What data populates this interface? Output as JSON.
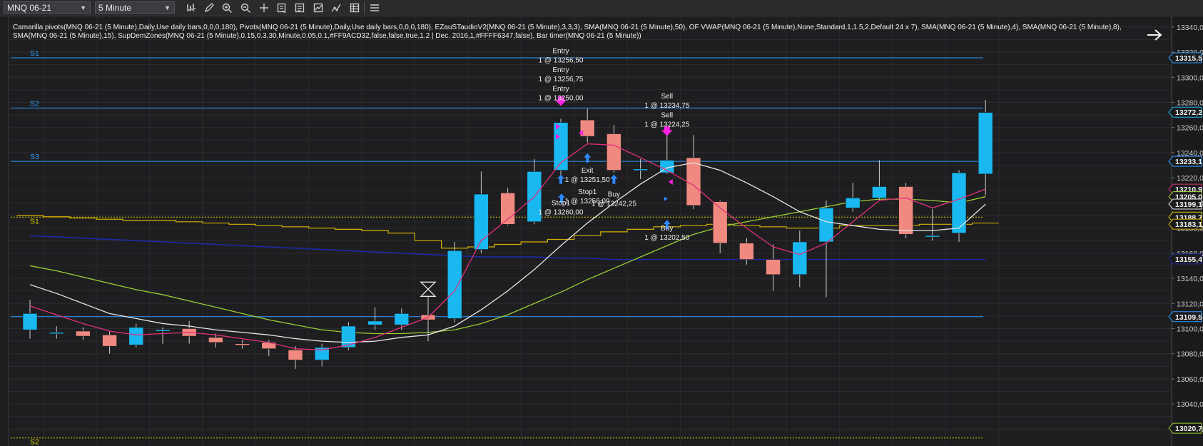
{
  "toolbar": {
    "instrument": "MNQ 06-21",
    "interval": "5 Minute",
    "tools": [
      "bar-style-icon",
      "draw-pen-icon",
      "zoom-in-icon",
      "zoom-out-icon",
      "crosshair-icon",
      "data-box-icon",
      "properties-icon",
      "indicators-icon",
      "strategies-icon",
      "menu-icon"
    ]
  },
  "indicators_text": "Camarilla pivots(MNQ 06-21 (5 Minute),Daily,Use daily bars,0,0,0,180), Pivots(MNQ 06-21 (5 Minute),Daily,Use daily bars,0,0,0,180), EZauSTaudioV2(MNQ 06-21 (5 Minute),3,3,3), SMA(MNQ 06-21 (5 Minute),50), OF VWAP(MNQ 06-21 (5 Minute),None,Standard,1,1.5,2,Default 24 x 7), SMA(MNQ 06-21 (5 Minute),4), SMA(MNQ 06-21 (5 Minute),8), SMA(MNQ 06-21 (5 Minute),15), SupDemZones(MNQ 06-21 (5 Minute),0.15,0.3,30,Minute,0.05,0.1,#FF9ACD32,false,false,true,1.2 | Dec. 2016,1,#FFFF6347,false), Bar timer(MNQ 06-21 (5 Minute))",
  "colors": {
    "up": "#19b8f0",
    "down": "#f08a80",
    "sma4": "#e0307a",
    "sma8": "#e6e6e6",
    "sma15": "#9acd32",
    "sma50": "#1c2aa6",
    "vwap": "#d4b106",
    "camarilla": "#2f9bff",
    "pivot": "#d8d000",
    "marker": "#ff22e0",
    "arrow": "#2e8bff"
  },
  "chart_data": {
    "type": "candlestick",
    "y_range": [
      13010,
      13345
    ],
    "y_ticks": [
      "13340,00",
      "13320,00",
      "13300,00",
      "13280,00",
      "13260,00",
      "13240,00",
      "13220,00",
      "13200,00",
      "13180,00",
      "13160,00",
      "13140,00",
      "13120,00",
      "13100,00",
      "13080,00",
      "13060,00",
      "13040,00",
      "13020,00"
    ],
    "price_labels": [
      {
        "text": "13315,5",
        "value": 13315.5,
        "color": "#2f9bff"
      },
      {
        "text": "13272,2",
        "value": 13272.2,
        "color": "#19b8f0"
      },
      {
        "text": "13233,1",
        "value": 13233.1,
        "color": "#2f9bff"
      },
      {
        "text": "13210,9",
        "value": 13210.9,
        "color": "#e0307a"
      },
      {
        "text": "13205,0",
        "value": 13205.0,
        "color": "#9acd32"
      },
      {
        "text": "13199,1",
        "value": 13199.1,
        "color": "#e6e6e6"
      },
      {
        "text": "13188,7",
        "value": 13188.7,
        "color": "#d8d000"
      },
      {
        "text": "13183,1",
        "value": 13183.1,
        "color": "#d4b106"
      },
      {
        "text": "13155,4",
        "value": 13155.4,
        "color": "#1c2aa6"
      },
      {
        "text": "13109,5",
        "value": 13109.5,
        "color": "#2f9bff"
      },
      {
        "text": "13020,7",
        "value": 13020.7,
        "color": "#9acd32"
      }
    ],
    "levels": [
      {
        "label": "S1",
        "value": 13315.5,
        "kind": "camarilla"
      },
      {
        "label": "S2",
        "value": 13275.5,
        "kind": "camarilla"
      },
      {
        "label": "S3",
        "value": 13233.1,
        "kind": "camarilla"
      },
      {
        "label": "",
        "value": 13109.5,
        "kind": "camarilla"
      },
      {
        "label": "S1",
        "value": 13188.7,
        "kind": "pivot"
      },
      {
        "label": "S2",
        "value": 13013.0,
        "kind": "pivot"
      }
    ],
    "candles": [
      {
        "o": 13099,
        "h": 13123,
        "l": 13092,
        "c": 13112
      },
      {
        "o": 13096,
        "h": 13102,
        "l": 13092,
        "c": 13097
      },
      {
        "o": 13098,
        "h": 13101,
        "l": 13091,
        "c": 13094
      },
      {
        "o": 13095,
        "h": 13098,
        "l": 13080,
        "c": 13086
      },
      {
        "o": 13087,
        "h": 13104,
        "l": 13085,
        "c": 13101
      },
      {
        "o": 13099,
        "h": 13101,
        "l": 13088,
        "c": 13099
      },
      {
        "o": 13100,
        "h": 13106,
        "l": 13088,
        "c": 13094
      },
      {
        "o": 13093,
        "h": 13096,
        "l": 13085,
        "c": 13089
      },
      {
        "o": 13088,
        "h": 13091,
        "l": 13084,
        "c": 13087
      },
      {
        "o": 13089,
        "h": 13091,
        "l": 13078,
        "c": 13084
      },
      {
        "o": 13083,
        "h": 13086,
        "l": 13068,
        "c": 13075
      },
      {
        "o": 13075,
        "h": 13088,
        "l": 13070,
        "c": 13085
      },
      {
        "o": 13085,
        "h": 13105,
        "l": 13083,
        "c": 13102
      },
      {
        "o": 13103,
        "h": 13117,
        "l": 13099,
        "c": 13106
      },
      {
        "o": 13103,
        "h": 13116,
        "l": 13099,
        "c": 13112
      },
      {
        "o": 13111,
        "h": 13126,
        "l": 13090,
        "c": 13107
      },
      {
        "o": 13108,
        "h": 13169,
        "l": 13105,
        "c": 13162
      },
      {
        "o": 13163,
        "h": 13225,
        "l": 13160,
        "c": 13207
      },
      {
        "o": 13208,
        "h": 13212,
        "l": 13182,
        "c": 13183
      },
      {
        "o": 13185,
        "h": 13235,
        "l": 13183,
        "c": 13225
      },
      {
        "o": 13226,
        "h": 13267,
        "l": 13220,
        "c": 13264
      },
      {
        "o": 13266,
        "h": 13275,
        "l": 13248,
        "c": 13253
      },
      {
        "o": 13255,
        "h": 13262,
        "l": 13224,
        "c": 13226
      },
      {
        "o": 13227,
        "h": 13235,
        "l": 13219,
        "c": 13227
      },
      {
        "o": 13224,
        "h": 13256,
        "l": 13223,
        "c": 13234
      },
      {
        "o": 13236,
        "h": 13254,
        "l": 13195,
        "c": 13198
      },
      {
        "o": 13201,
        "h": 13202,
        "l": 13160,
        "c": 13168
      },
      {
        "o": 13168,
        "h": 13172,
        "l": 13151,
        "c": 13155
      },
      {
        "o": 13155,
        "h": 13167,
        "l": 13130,
        "c": 13143
      },
      {
        "o": 13143,
        "h": 13178,
        "l": 13133,
        "c": 13169
      },
      {
        "o": 13169,
        "h": 13202,
        "l": 13125,
        "c": 13196
      },
      {
        "o": 13196,
        "h": 13216,
        "l": 13193,
        "c": 13204
      },
      {
        "o": 13204,
        "h": 13234,
        "l": 13202,
        "c": 13213
      },
      {
        "o": 13213,
        "h": 13216,
        "l": 13172,
        "c": 13175
      },
      {
        "o": 13174,
        "h": 13195,
        "l": 13170,
        "c": 13174
      },
      {
        "o": 13176,
        "h": 13226,
        "l": 13169,
        "c": 13224
      },
      {
        "o": 13223,
        "h": 13282,
        "l": 13206,
        "c": 13272
      }
    ],
    "sma4": [
      13118,
      13111,
      13104,
      13098,
      13095,
      13096,
      13097,
      13095,
      13092,
      13089,
      13084,
      13083,
      13087,
      13093,
      13101,
      13109,
      13130,
      13170,
      13187,
      13205,
      13232,
      13247,
      13246,
      13236,
      13226,
      13214,
      13196,
      13180,
      13165,
      13159,
      13168,
      13185,
      13202,
      13204,
      13196,
      13203,
      13211
    ],
    "sma8": [
      13135,
      13128,
      13120,
      13112,
      13108,
      13104,
      13102,
      13099,
      13097,
      13095,
      13092,
      13090,
      13089,
      13090,
      13093,
      13095,
      13102,
      13115,
      13130,
      13147,
      13166,
      13184,
      13200,
      13215,
      13228,
      13232,
      13226,
      13216,
      13205,
      13193,
      13185,
      13182,
      13179,
      13178,
      13178,
      13180,
      13199
    ],
    "sma15": [
      13150,
      13146,
      13141,
      13136,
      13131,
      13127,
      13122,
      13117,
      13112,
      13107,
      13103,
      13099,
      13097,
      13096,
      13096,
      13097,
      13099,
      13104,
      13111,
      13120,
      13129,
      13139,
      13148,
      13157,
      13166,
      13175,
      13181,
      13185,
      13189,
      13193,
      13197,
      13201,
      13203,
      13203,
      13202,
      13200,
      13205
    ],
    "sma50": [
      13174,
      13173,
      13172,
      13171,
      13170,
      13169,
      13168,
      13167,
      13166,
      13165,
      13164,
      13163,
      13162,
      13161,
      13160,
      13159,
      13158,
      13157,
      13157,
      13157,
      13156,
      13156,
      13155,
      13155,
      13155,
      13155,
      13155,
      13155,
      13155,
      13155,
      13155,
      13155,
      13155,
      13155,
      13155,
      13155,
      13155
    ],
    "vwap": [
      13190,
      13189,
      13188,
      13187,
      13186,
      13186,
      13185,
      13184,
      13183,
      13182,
      13181,
      13180,
      13179,
      13178,
      13176,
      13170,
      13164,
      13165,
      13167,
      13169,
      13171,
      13174,
      13177,
      13179,
      13181,
      13182,
      13183,
      13182,
      13181,
      13180,
      13180,
      13182,
      13182,
      13182,
      13183,
      13183,
      13184
    ],
    "annotations": [
      {
        "label": "Entry",
        "qty": "1 @ 13256,50",
        "bar": 20,
        "value": 13314
      },
      {
        "label": "Entry",
        "qty": "1 @ 13256,75",
        "bar": 20,
        "value": 13299
      },
      {
        "label": "Entry",
        "qty": "1 @ 13250,00",
        "bar": 20,
        "value": 13284
      },
      {
        "label": "Sell",
        "qty": "1 @ 13234,75",
        "bar": 24,
        "value": 13278
      },
      {
        "label": "Sell",
        "qty": "1 @ 13224,25",
        "bar": 24,
        "value": 13263
      },
      {
        "label": "Exit",
        "qty": "1 @ 13251,50",
        "bar": 21,
        "value": 13219
      },
      {
        "label": "Stop1",
        "qty": "1 @ 13256,00",
        "bar": 21,
        "value": 13202
      },
      {
        "label": "Buy",
        "qty": "1 @ 13242,25",
        "bar": 22,
        "value": 13200
      },
      {
        "label": "Stop1",
        "qty": "1 @ 13260,00",
        "bar": 20,
        "value": 13193
      },
      {
        "label": "Buy",
        "qty": "1 @ 13202,50",
        "bar": 24,
        "value": 13173
      }
    ]
  }
}
